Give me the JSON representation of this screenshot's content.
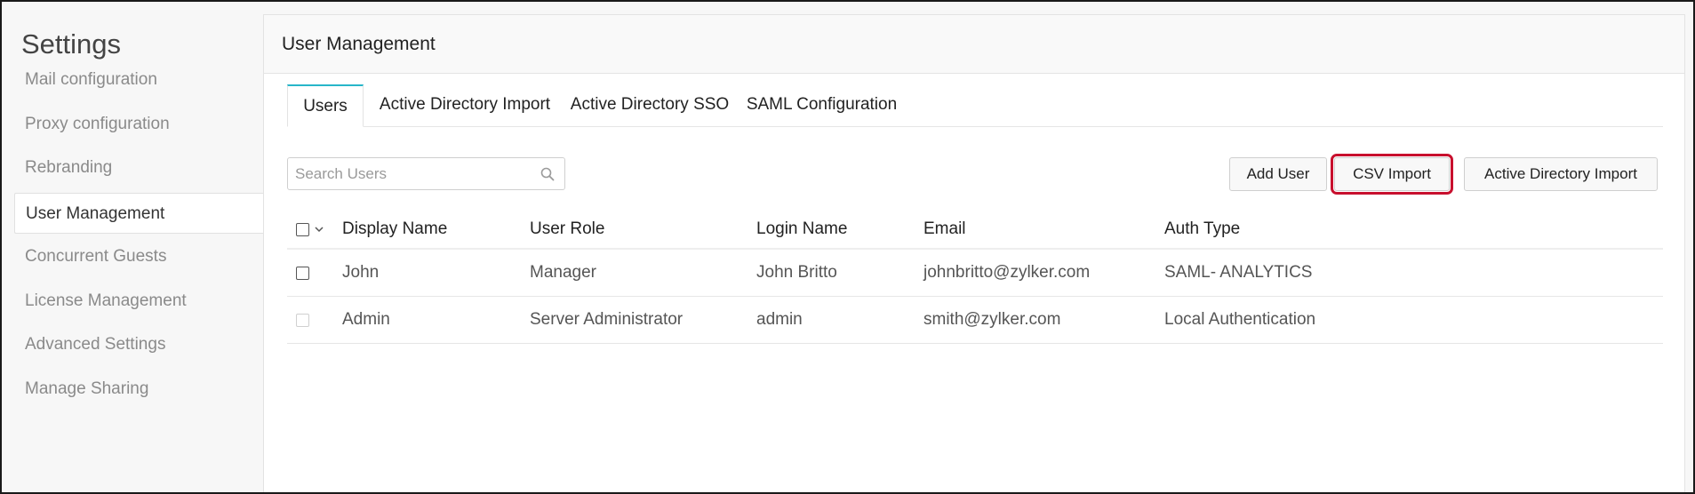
{
  "sidebar": {
    "title": "Settings",
    "items": [
      {
        "label": "Mail configuration",
        "active": false
      },
      {
        "label": "Proxy configuration",
        "active": false
      },
      {
        "label": "Rebranding",
        "active": false
      },
      {
        "label": "User Management",
        "active": true
      },
      {
        "label": "Concurrent Guests",
        "active": false
      },
      {
        "label": "License Management",
        "active": false
      },
      {
        "label": "Advanced Settings",
        "active": false
      },
      {
        "label": "Manage Sharing",
        "active": false
      }
    ]
  },
  "main": {
    "title": "User Management",
    "tabs": [
      {
        "label": "Users",
        "active": true
      },
      {
        "label": "Active Directory Import",
        "active": false
      },
      {
        "label": "Active Directory SSO",
        "active": false
      },
      {
        "label": "SAML Configuration",
        "active": false
      }
    ],
    "search": {
      "placeholder": "Search Users",
      "value": ""
    },
    "buttons": {
      "add_user": "Add User",
      "csv_import": "CSV Import",
      "ad_import": "Active Directory Import"
    },
    "table": {
      "columns": [
        "Display Name",
        "User Role",
        "Login Name",
        "Email",
        "Auth Type"
      ],
      "rows": [
        {
          "display_name": "John",
          "user_role": "Manager",
          "login_name": "John Britto",
          "email": "johnbritto@zylker.com",
          "auth_type": "SAML- ANALYTICS",
          "selectable": true
        },
        {
          "display_name": "Admin",
          "user_role": "Server Administrator",
          "login_name": "admin",
          "email": "smith@zylker.com",
          "auth_type": "Local Authentication",
          "selectable": false
        }
      ]
    }
  },
  "colors": {
    "accent_tab": "#27b6c9",
    "highlight": "#c8102e"
  }
}
